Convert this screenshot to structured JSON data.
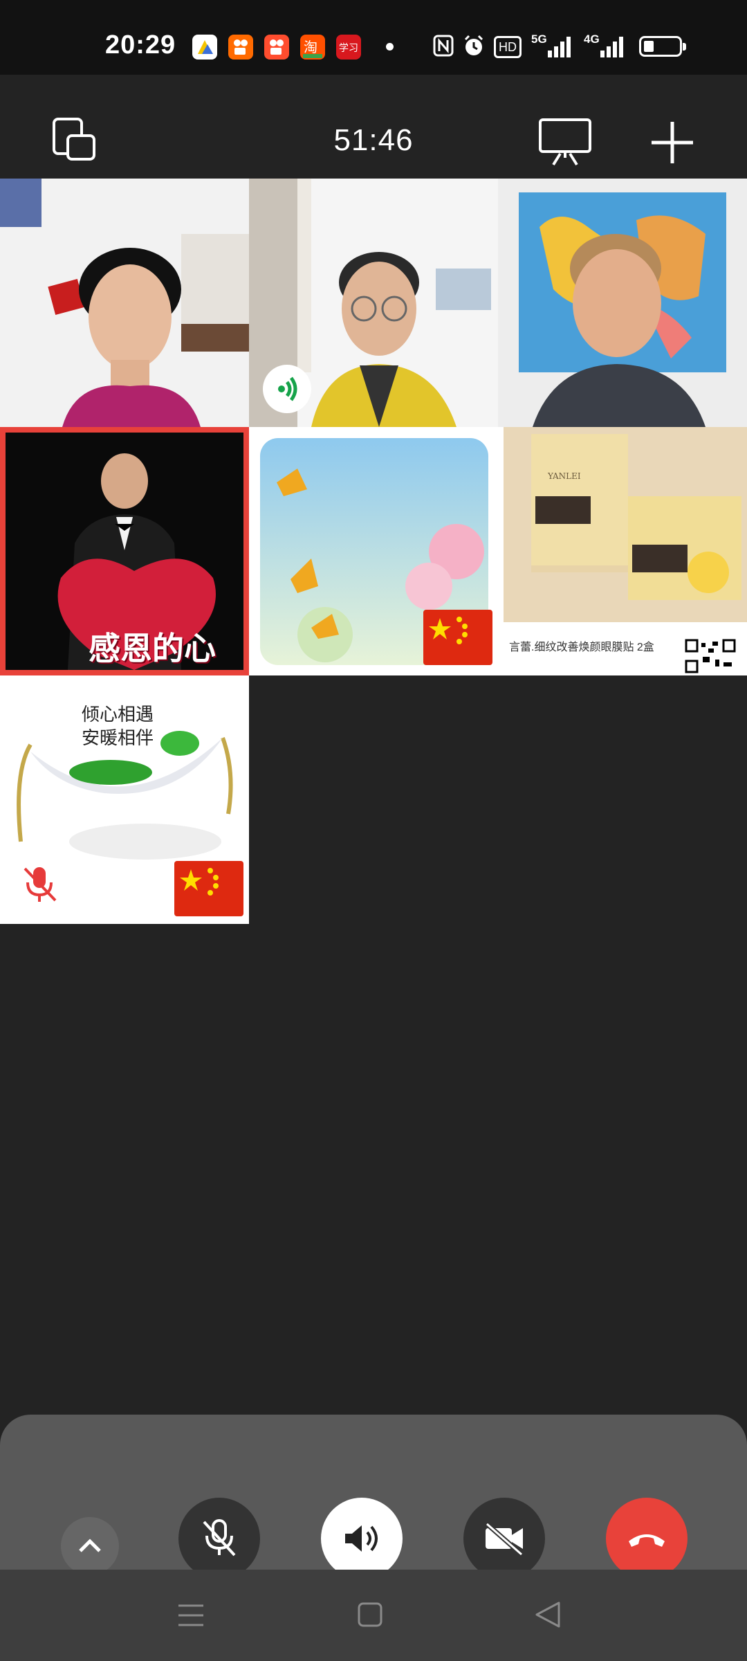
{
  "status_bar": {
    "time": "20:29",
    "apps": [
      {
        "name": "app-icon-1",
        "color": "#f5c400"
      },
      {
        "name": "kuaishou-icon",
        "color": "#ff6a00"
      },
      {
        "name": "kuaishou-lite-icon",
        "color": "#ff4d2e"
      },
      {
        "name": "taobao-icon",
        "color": "#ff5000"
      },
      {
        "name": "xuexi-icon",
        "color": "#d8181e"
      }
    ],
    "icons": [
      "nfc-icon",
      "alarm-icon",
      "hd-icon",
      "5g-signal-icon",
      "4g-signal-icon",
      "battery-icon"
    ],
    "hd_label": "HD",
    "net1": "5G",
    "net2": "4G"
  },
  "call": {
    "timer": "51:46",
    "icons": [
      "minimize-window-icon",
      "screen-share-icon",
      "add-participant-icon"
    ]
  },
  "tiles": [
    {
      "name": "participant-tile-1"
    },
    {
      "name": "participant-tile-2",
      "speaking": true
    },
    {
      "name": "participant-tile-3"
    },
    {
      "name": "participant-tile-4",
      "active": true,
      "overlay_text": "感恩的心"
    },
    {
      "name": "participant-tile-5"
    },
    {
      "name": "participant-tile-6",
      "brand": "YANLEI",
      "caption": "言蕾.细纹改善焕颜眼膜贴  2盒"
    },
    {
      "name": "participant-tile-7",
      "muted": true,
      "line1": "倾心相遇",
      "line2": "安暖相伴"
    }
  ],
  "controls": [
    {
      "name": "expand-button",
      "icon": "chevron-up-icon"
    },
    {
      "name": "mute-button",
      "icon": "microphone-off-icon"
    },
    {
      "name": "speaker-button",
      "icon": "speaker-icon"
    },
    {
      "name": "camera-button",
      "icon": "camera-off-icon"
    },
    {
      "name": "hangup-button",
      "icon": "phone-hangup-icon"
    }
  ],
  "colors": {
    "background": "#232323",
    "panel": "#595959",
    "hangup": "#e8423a",
    "active_border": "#e8423a"
  }
}
